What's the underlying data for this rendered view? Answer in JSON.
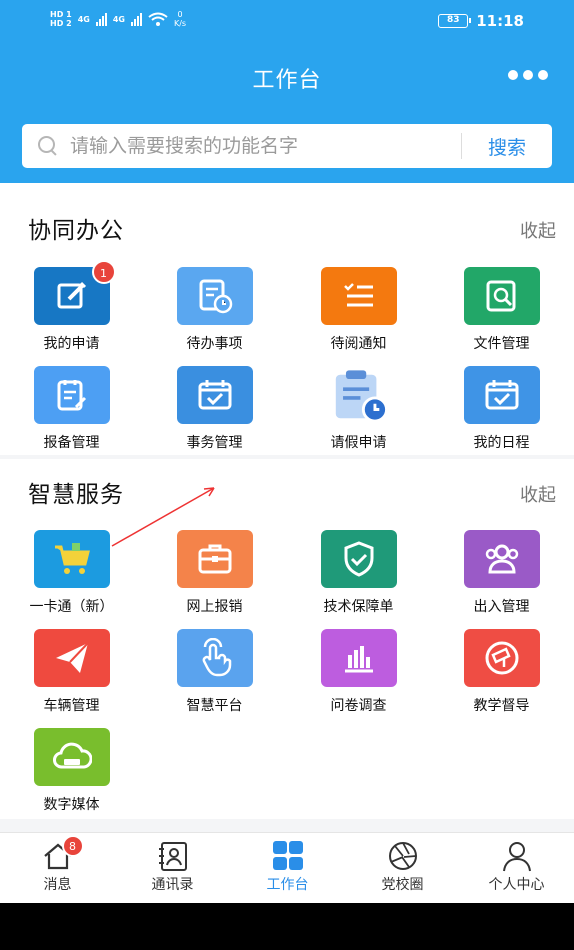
{
  "status": {
    "net_top": "0",
    "net_unit": "K/s",
    "battery": "83",
    "time": "11:18",
    "hd1": "HD 1",
    "hd2": "HD 2",
    "net1": "4G",
    "net2": "4G"
  },
  "header": {
    "title": "工作台"
  },
  "search": {
    "placeholder": "请输入需要搜索的功能名字",
    "button": "搜索"
  },
  "sections": [
    {
      "title": "协同办公",
      "collapse": "收起",
      "items": [
        {
          "label": "我的申请",
          "icon": "edit-icon",
          "color": "#1777c4",
          "badge": "1"
        },
        {
          "label": "待办事项",
          "icon": "todo-clock-icon",
          "color": "#5aa7f0"
        },
        {
          "label": "待阅通知",
          "icon": "list-icon",
          "color": "#f4790f"
        },
        {
          "label": "文件管理",
          "icon": "file-search-icon",
          "color": "#22a768"
        },
        {
          "label": "报备管理",
          "icon": "clipboard-edit-icon",
          "color": "#4d9ff3"
        },
        {
          "label": "事务管理",
          "icon": "calendar-check-icon",
          "color": "#3a8fe0"
        },
        {
          "label": "请假申请",
          "icon": "clipboard-clock-icon",
          "color": "#ffffff"
        },
        {
          "label": "我的日程",
          "icon": "calendar-check-icon",
          "color": "#3f94e6"
        }
      ]
    },
    {
      "title": "智慧服务",
      "collapse": "收起",
      "items": [
        {
          "label": "一卡通（新）",
          "icon": "cart-icon",
          "color": "#1c9be0"
        },
        {
          "label": "网上报销",
          "icon": "briefcase-icon",
          "color": "#f4834a"
        },
        {
          "label": "技术保障单",
          "icon": "shield-check-icon",
          "color": "#1f9a79"
        },
        {
          "label": "出入管理",
          "icon": "users-icon",
          "color": "#9a5ac7"
        },
        {
          "label": "车辆管理",
          "icon": "paper-plane-icon",
          "color": "#ef4a3f"
        },
        {
          "label": "智慧平台",
          "icon": "touch-hand-icon",
          "color": "#5aa3ee"
        },
        {
          "label": "问卷调查",
          "icon": "bar-chart-icon",
          "color": "#bd5ddf"
        },
        {
          "label": "教学督导",
          "icon": "camera-badge-icon",
          "color": "#ef4d44"
        },
        {
          "label": "数字媒体",
          "icon": "cloud-drive-icon",
          "color": "#79be2d"
        }
      ]
    }
  ],
  "nav": [
    {
      "label": "消息",
      "icon": "home-icon",
      "badge": "8",
      "active": false
    },
    {
      "label": "通讯录",
      "icon": "contacts-icon",
      "active": false
    },
    {
      "label": "工作台",
      "icon": "grid-icon",
      "active": true
    },
    {
      "label": "党校圈",
      "icon": "aperture-icon",
      "active": false
    },
    {
      "label": "个人中心",
      "icon": "person-icon",
      "active": false
    }
  ]
}
